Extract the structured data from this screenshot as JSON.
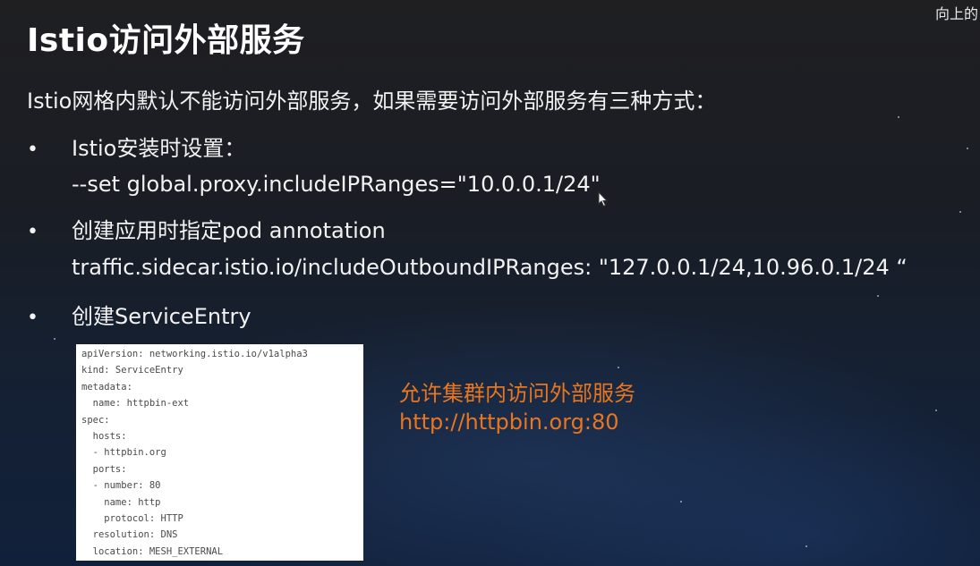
{
  "corner": {
    "text": "向上的"
  },
  "title": "Istio访问外部服务",
  "intro": "Istio网格内默认不能访问外部服务，如果需要访问外部服务有三种方式：",
  "bullets": [
    {
      "label": "Istio安装时设置：",
      "detail": "--set global.proxy.includeIPRanges=\"10.0.0.1/24\""
    },
    {
      "label": "创建应用时指定pod annotation",
      "detail": "traffic.sidecar.istio.io/includeOutboundIPRanges: \"127.0.0.1/24,10.96.0.1/24 “"
    },
    {
      "label": "创建ServiceEntry"
    }
  ],
  "code": [
    "apiVersion: networking.istio.io/v1alpha3",
    "kind: ServiceEntry",
    "metadata:",
    "  name: httpbin-ext",
    "spec:",
    "  hosts:",
    "  - httpbin.org",
    "  ports:",
    "  - number: 80",
    "    name: http",
    "    protocol: HTTP",
    "  resolution: DNS",
    "  location: MESH_EXTERNAL"
  ],
  "annotation": {
    "line1": "允许集群内访问外部服务",
    "line2": "http://httpbin.org:80",
    "color": "#e8761f"
  },
  "icons": {
    "cursor": "mouse-pointer-icon"
  }
}
